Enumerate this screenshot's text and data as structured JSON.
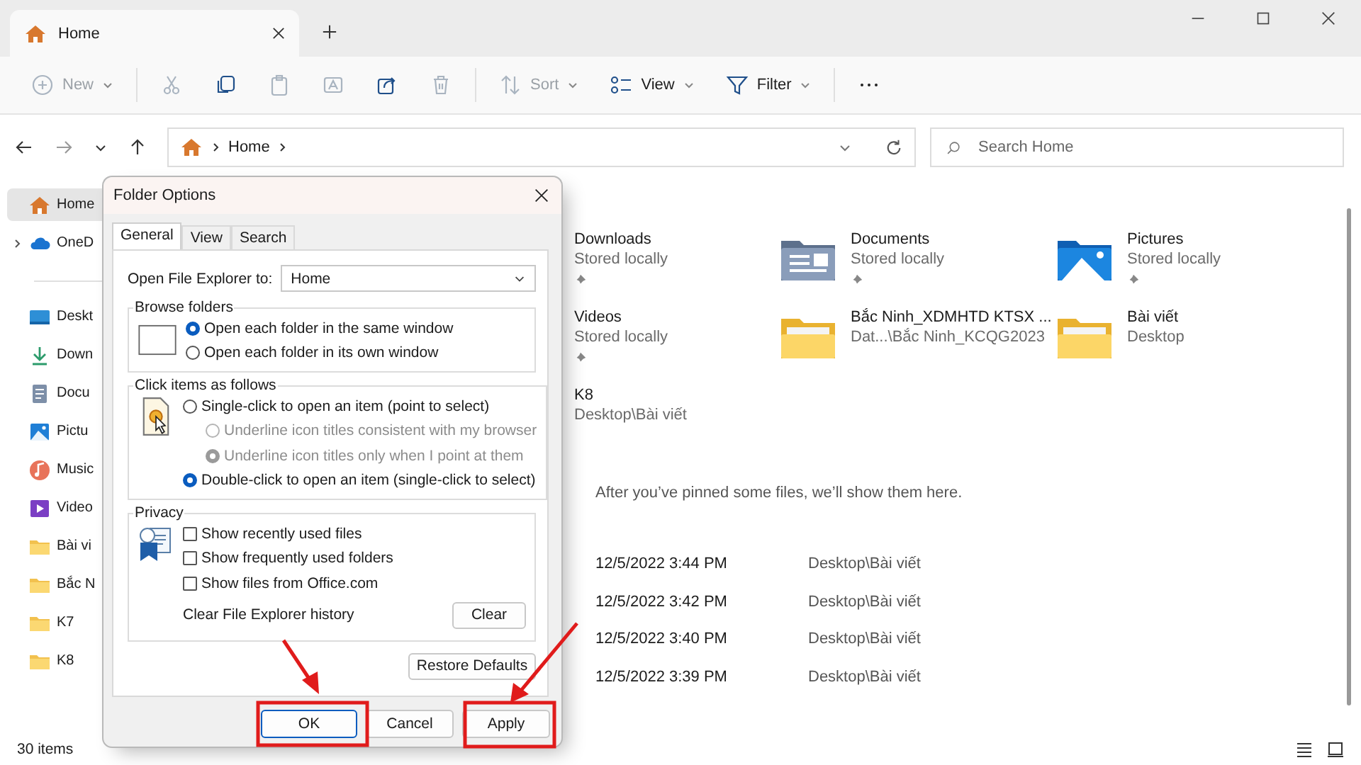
{
  "window": {
    "tab": {
      "title": "Home"
    }
  },
  "toolbar": {
    "groups": [
      [
        {
          "kind": "new",
          "label": "New",
          "dropdown": true,
          "disabled": true
        }
      ],
      [
        {
          "kind": "cut",
          "disabled": true
        },
        {
          "kind": "copy",
          "disabled": false
        },
        {
          "kind": "paste",
          "disabled": true
        },
        {
          "kind": "rename",
          "disabled": true
        },
        {
          "kind": "share",
          "disabled": false
        },
        {
          "kind": "delete",
          "disabled": true
        }
      ],
      [
        {
          "kind": "sort",
          "label": "Sort",
          "dropdown": true,
          "disabled": true
        },
        {
          "kind": "view",
          "label": "View",
          "dropdown": true,
          "disabled": false
        },
        {
          "kind": "filter",
          "label": "Filter",
          "dropdown": true,
          "disabled": false
        }
      ],
      [
        {
          "kind": "more",
          "disabled": false
        }
      ]
    ]
  },
  "address": {
    "crumbs": [
      "Home"
    ]
  },
  "search": {
    "placeholder": "Search Home"
  },
  "sidebar": {
    "items": [
      {
        "label": "Home",
        "kind": "home",
        "selected": true,
        "expandable": false
      },
      {
        "label": "OneD",
        "kind": "cloud",
        "selected": false,
        "expandable": true
      },
      {
        "label": "Deskt",
        "kind": "desktop",
        "selected": false,
        "expandable": false
      },
      {
        "label": "Down",
        "kind": "download",
        "selected": false,
        "expandable": false
      },
      {
        "label": "Docu",
        "kind": "documents",
        "selected": false,
        "expandable": false
      },
      {
        "label": "Pictu",
        "kind": "pictures",
        "selected": false,
        "expandable": false
      },
      {
        "label": "Music",
        "kind": "music",
        "selected": false,
        "expandable": false
      },
      {
        "label": "Video",
        "kind": "videos",
        "selected": false,
        "expandable": false
      },
      {
        "label": "Bài vi",
        "kind": "folder",
        "selected": false,
        "expandable": false
      },
      {
        "label": "Bắc N",
        "kind": "folder",
        "selected": false,
        "expandable": false
      },
      {
        "label": "K7",
        "kind": "folder",
        "selected": false,
        "expandable": false
      },
      {
        "label": "K8",
        "kind": "folder",
        "selected": false,
        "expandable": false
      }
    ]
  },
  "quick_access": [
    {
      "name": "Downloads",
      "detail": "Stored locally",
      "pinned": true
    },
    {
      "name": "Documents",
      "detail": "Stored locally",
      "pinned": true,
      "kind": "documents"
    },
    {
      "name": "Pictures",
      "detail": "Stored locally",
      "pinned": true,
      "kind": "pictures"
    },
    {
      "name": "Videos",
      "detail": "Stored locally",
      "pinned": true
    },
    {
      "name": "Bắc Ninh_XDMHTD KTSX ...",
      "detail": "Dat...\\Bắc Ninh_KCQG2023",
      "pinned": false,
      "kind": "folder"
    },
    {
      "name": "Bài viết",
      "detail": "Desktop",
      "pinned": false,
      "kind": "folder"
    },
    {
      "name": "K8",
      "detail": "Desktop\\Bài viết",
      "pinned": false
    }
  ],
  "favorites_message": "After you’ve pinned some files, we’ll show them here.",
  "recent": [
    {
      "date": "12/5/2022 3:44 PM",
      "location": "Desktop\\Bài viết"
    },
    {
      "date": "12/5/2022 3:42 PM",
      "location": "Desktop\\Bài viết"
    },
    {
      "date": "12/5/2022 3:40 PM",
      "location": "Desktop\\Bài viết"
    },
    {
      "date": "12/5/2022 3:39 PM",
      "location": "Desktop\\Bài viết"
    }
  ],
  "status_bar": {
    "count": "30 items"
  },
  "dialog": {
    "title": "Folder Options",
    "tabs": [
      {
        "label": "General",
        "selected": true
      },
      {
        "label": "View",
        "selected": false
      },
      {
        "label": "Search",
        "selected": false
      }
    ],
    "open_to": {
      "label": "Open File Explorer to:",
      "value": "Home"
    },
    "browse_folders": {
      "title": "Browse folders",
      "options": [
        {
          "label": "Open each folder in the same window",
          "selected": true
        },
        {
          "label": "Open each folder in its own window",
          "selected": false
        }
      ]
    },
    "click_items": {
      "title": "Click items as follows",
      "options": [
        {
          "label": "Single-click to open an item (point to select)",
          "selected": false,
          "disabled": false,
          "children": [
            {
              "label": "Underline icon titles consistent with my browser",
              "selected": false,
              "disabled": true
            },
            {
              "label": "Underline icon titles only when I point at them",
              "selected": true,
              "disabled": true
            }
          ]
        },
        {
          "label": "Double-click to open an item (single-click to select)",
          "selected": true,
          "disabled": false
        }
      ]
    },
    "privacy": {
      "title": "Privacy",
      "options": [
        {
          "label": "Show recently used files",
          "checked": false
        },
        {
          "label": "Show frequently used folders",
          "checked": false
        },
        {
          "label": "Show files from Office.com",
          "checked": false
        }
      ],
      "clear_label": "Clear File Explorer history",
      "clear_button": "Clear"
    },
    "restore_button": "Restore Defaults",
    "buttons": [
      "OK",
      "Cancel",
      "Apply"
    ]
  }
}
